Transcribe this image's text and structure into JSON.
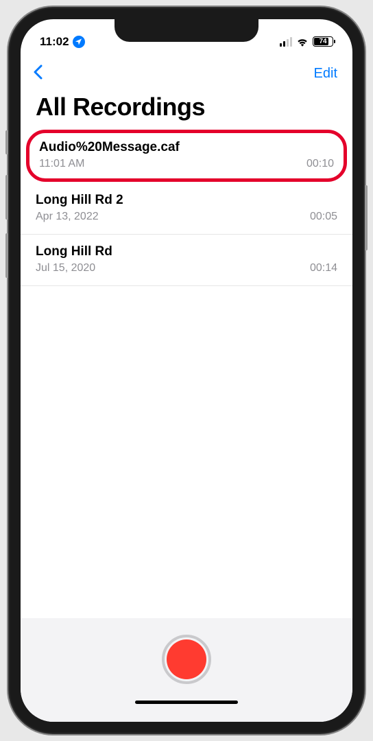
{
  "status": {
    "time": "11:02",
    "battery_percent": "74"
  },
  "nav": {
    "edit_label": "Edit"
  },
  "header": {
    "title": "All Recordings"
  },
  "recordings": [
    {
      "name": "Audio%20Message.caf",
      "date": "11:01 AM",
      "duration": "00:10",
      "highlighted": true
    },
    {
      "name": "Long Hill Rd 2",
      "date": "Apr 13, 2022",
      "duration": "00:05",
      "highlighted": false
    },
    {
      "name": "Long Hill Rd",
      "date": "Jul 15, 2020",
      "duration": "00:14",
      "highlighted": false
    }
  ]
}
